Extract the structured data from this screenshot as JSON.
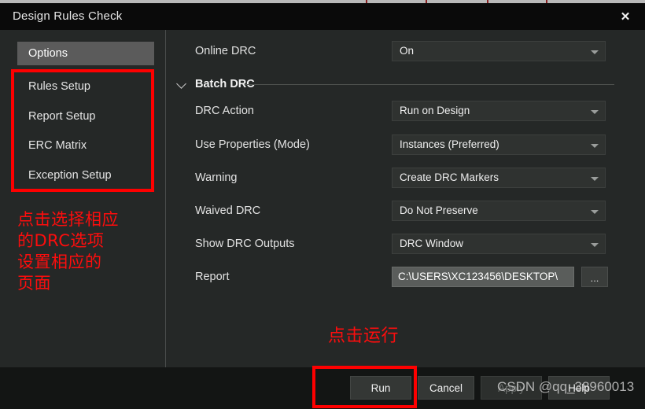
{
  "window": {
    "title": "Design Rules Check",
    "close_icon": "close-icon"
  },
  "sidebar": {
    "items": [
      {
        "label": "Options",
        "selected": true
      },
      {
        "label": "Rules Setup",
        "selected": false
      },
      {
        "label": "Report Setup",
        "selected": false
      },
      {
        "label": "ERC Matrix",
        "selected": false
      },
      {
        "label": "Exception Setup",
        "selected": false
      }
    ]
  },
  "annotations": {
    "sidebar_note": "点击选择相应\n的DRC选项\n设置相应的\n页面",
    "run_note": "点击运行",
    "highlight_color": "#fe0000"
  },
  "form": {
    "online_drc": {
      "label": "Online DRC",
      "value": "On"
    },
    "section": {
      "label": "Batch DRC",
      "chevron_icon": "chevron-down-icon",
      "expanded": true
    },
    "drc_action": {
      "label": "DRC Action",
      "value": "Run on Design"
    },
    "use_properties": {
      "label": "Use Properties (Mode)",
      "value": "Instances (Preferred)"
    },
    "warning": {
      "label": "Warning",
      "value": "Create DRC Markers"
    },
    "waived_drc": {
      "label": "Waived DRC",
      "value": "Do Not Preserve"
    },
    "show_drc_outputs": {
      "label": "Show DRC Outputs",
      "value": "DRC Window"
    },
    "report": {
      "label": "Report",
      "value": "C:\\USERS\\XC123456\\DESKTOP\\",
      "browse_label": "..."
    }
  },
  "footer": {
    "run_label": "Run",
    "cancel_label": "Cancel",
    "apply_label": "Apply",
    "help_label": "Help"
  },
  "watermark": {
    "text": "CSDN @qq_38960013"
  }
}
